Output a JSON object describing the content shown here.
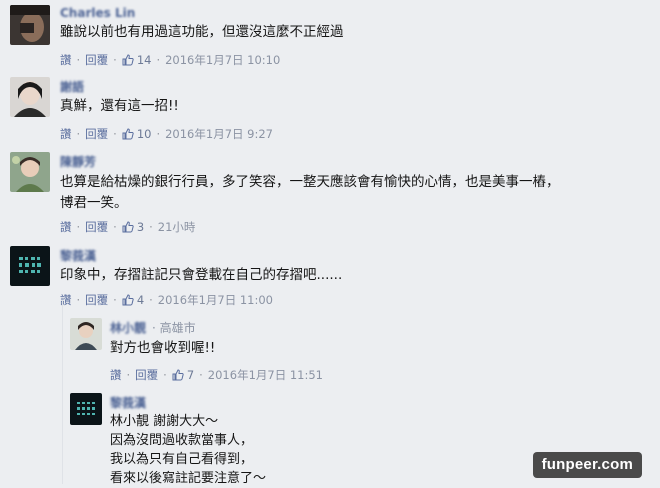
{
  "actions": {
    "reply": "回覆",
    "like_prefix_glyph": "讚",
    "separator": "·"
  },
  "comments": [
    {
      "name": "Charles Lin",
      "text": "雖說以前也有用過這功能，但還沒這麼不正經過",
      "likes": "14",
      "time": "2016年1月7日 10:10"
    },
    {
      "name": "謝語",
      "text": "真鮮，還有這一招!!",
      "likes": "10",
      "time": "2016年1月7日 9:27"
    },
    {
      "name": "陳靜芳",
      "text": "也算是給枯燥的銀行行員，多了笑容，一整天應該會有愉快的心情，也是美事一樁，\n博君一笑。",
      "likes": "3",
      "time": "21小時"
    },
    {
      "name": "黎莪漢",
      "text": "印象中，存摺註記只會登載在自己的存摺吧......",
      "likes": "4",
      "time": "2016年1月7日 11:00"
    }
  ],
  "replies": [
    {
      "name": "林小靚",
      "location": "· 高雄市",
      "text": "對方也會收到喔!!",
      "likes": "7",
      "time": "2016年1月7日 11:51"
    },
    {
      "name": "黎莪漢",
      "text": "林小靚 謝謝大大～\n因為沒問過收款當事人，\n我以為只有自己看得到，\n看來以後寫註記要注意了～"
    }
  ],
  "watermark": "funpeer.com"
}
